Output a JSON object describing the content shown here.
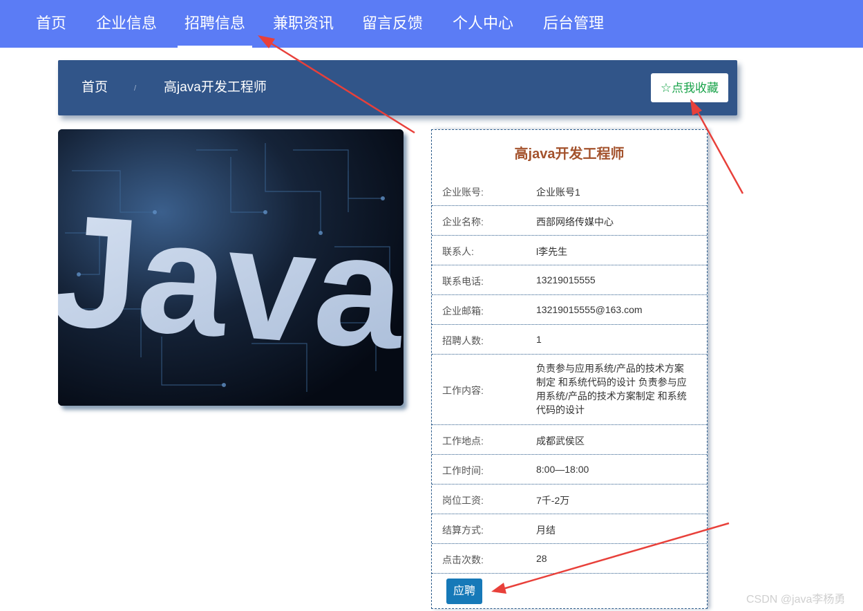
{
  "nav": {
    "items": [
      "首页",
      "企业信息",
      "招聘信息",
      "兼职资讯",
      "留言反馈",
      "个人中心",
      "后台管理"
    ],
    "active_index": 2
  },
  "breadcrumb": {
    "home": "首页",
    "separator": "/",
    "current": "高java开发工程师"
  },
  "favorite_button": {
    "icon": "star-outline-icon",
    "label": "点我收藏"
  },
  "image": {
    "text": "Java"
  },
  "detail": {
    "title": "高java开发工程师",
    "rows": [
      {
        "label": "企业账号:",
        "value": "企业账号1"
      },
      {
        "label": "企业名称:",
        "value": "西部网络传媒中心"
      },
      {
        "label": "联系人:",
        "value": "l李先生"
      },
      {
        "label": "联系电话:",
        "value": "13219015555"
      },
      {
        "label": "企业邮箱:",
        "value": "13219015555@163.com"
      },
      {
        "label": "招聘人数:",
        "value": "1"
      },
      {
        "label": "工作内容:",
        "value": "负责参与应用系统/产品的技术方案制定 和系统代码的设计 负责参与应用系统/产品的技术方案制定 和系统代码的设计"
      },
      {
        "label": "工作地点:",
        "value": "成都武侯区"
      },
      {
        "label": "工作时间:",
        "value": "8:00—18:00"
      },
      {
        "label": "岗位工资:",
        "value": "7千-2万"
      },
      {
        "label": "结算方式:",
        "value": "月结"
      },
      {
        "label": "点击次数:",
        "value": "28"
      }
    ],
    "apply_label": "应聘"
  },
  "watermark": "CSDN @java李杨勇",
  "colors": {
    "nav_bg": "#5b7cf5",
    "breadcrumb_bg": "#315589",
    "favorite_text": "#19a34a",
    "title_text": "#a3522c",
    "apply_bg": "#1679b8",
    "arrow": "#e8403a"
  }
}
